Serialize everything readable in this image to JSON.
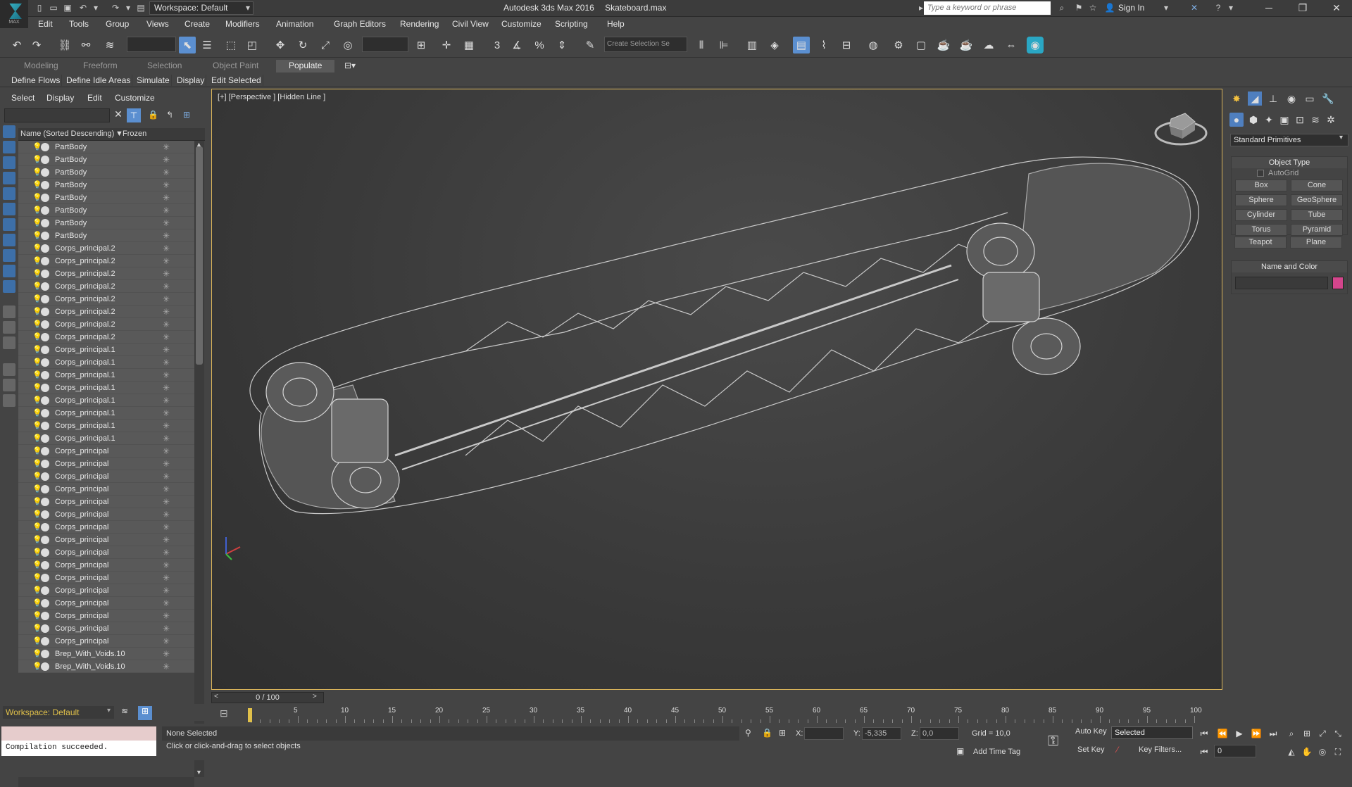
{
  "title_bar": {
    "app_title": "Autodesk 3ds Max 2016",
    "file_name": "Skateboard.max",
    "workspace": "Workspace: Default",
    "search_placeholder": "Type a keyword or phrase",
    "sign_in": "Sign In",
    "logo_sub": "MAX"
  },
  "menu": [
    "Edit",
    "Tools",
    "Group",
    "Views",
    "Create",
    "Modifiers",
    "Animation",
    "Graph Editors",
    "Rendering",
    "Civil View",
    "Customize",
    "Scripting",
    "Help"
  ],
  "toolbar": {
    "selection_set_placeholder": "Create Selection Se",
    "view_filter": ""
  },
  "ribbon": {
    "tabs": [
      "Modeling",
      "Freeform",
      "Selection",
      "Object Paint",
      "Populate"
    ],
    "active_tab": "Populate",
    "sub_items": [
      "Define Flows",
      "Define Idle Areas",
      "Simulate",
      "Display",
      "Edit Selected"
    ]
  },
  "scene_explorer": {
    "menu": [
      "Select",
      "Display",
      "Edit",
      "Customize"
    ],
    "col_name": "Name (Sorted Descending)",
    "col_frozen": "Frozen",
    "rows": [
      "PartBody",
      "PartBody",
      "PartBody",
      "PartBody",
      "PartBody",
      "PartBody",
      "PartBody",
      "PartBody",
      "Corps_principal.2",
      "Corps_principal.2",
      "Corps_principal.2",
      "Corps_principal.2",
      "Corps_principal.2",
      "Corps_principal.2",
      "Corps_principal.2",
      "Corps_principal.2",
      "Corps_principal.1",
      "Corps_principal.1",
      "Corps_principal.1",
      "Corps_principal.1",
      "Corps_principal.1",
      "Corps_principal.1",
      "Corps_principal.1",
      "Corps_principal.1",
      "Corps_principal",
      "Corps_principal",
      "Corps_principal",
      "Corps_principal",
      "Corps_principal",
      "Corps_principal",
      "Corps_principal",
      "Corps_principal",
      "Corps_principal",
      "Corps_principal",
      "Corps_principal",
      "Corps_principal",
      "Corps_principal",
      "Corps_principal",
      "Corps_principal",
      "Corps_principal",
      "Brep_With_Voids.10",
      "Brep_With_Voids.10"
    ],
    "frozen_icon": "✳",
    "workspace_bottom": "Workspace: Default"
  },
  "viewport": {
    "label": "[+] [Perspective ] [Hidden Line ]"
  },
  "command_panel": {
    "dropdown": "Standard Primitives",
    "object_type_title": "Object Type",
    "autogrid": "AutoGrid",
    "buttons": [
      "Box",
      "Cone",
      "Sphere",
      "GeoSphere",
      "Cylinder",
      "Tube",
      "Torus",
      "Pyramid",
      "Teapot",
      "Plane"
    ],
    "name_color_title": "Name and Color",
    "object_color": "#d4458c"
  },
  "timeline": {
    "slider": "0 / 100",
    "ticks": [
      "5",
      "10",
      "15",
      "20",
      "25",
      "30",
      "35",
      "40",
      "45",
      "50",
      "55",
      "60",
      "65",
      "70",
      "75",
      "80",
      "85",
      "90",
      "95",
      "100"
    ]
  },
  "status": {
    "maxscript_output": "Compilation succeeded.",
    "selection": "None Selected",
    "hint": "Click or click-and-drag to select objects",
    "x_label": "X:",
    "x_value": "",
    "y_label": "Y:",
    "y_value": "-5,335",
    "z_label": "Z:",
    "z_value": "0,0",
    "grid": "Grid = 10,0",
    "add_time_tag": "Add Time Tag",
    "auto_key": "Auto Key",
    "set_key": "Set Key",
    "selected": "Selected",
    "key_filters": "Key Filters...",
    "frame": "0"
  },
  "colors": {
    "accent": "#5b8fd0",
    "viewport_border": "#d8b35a",
    "active_tab": "#5a5a5a"
  }
}
